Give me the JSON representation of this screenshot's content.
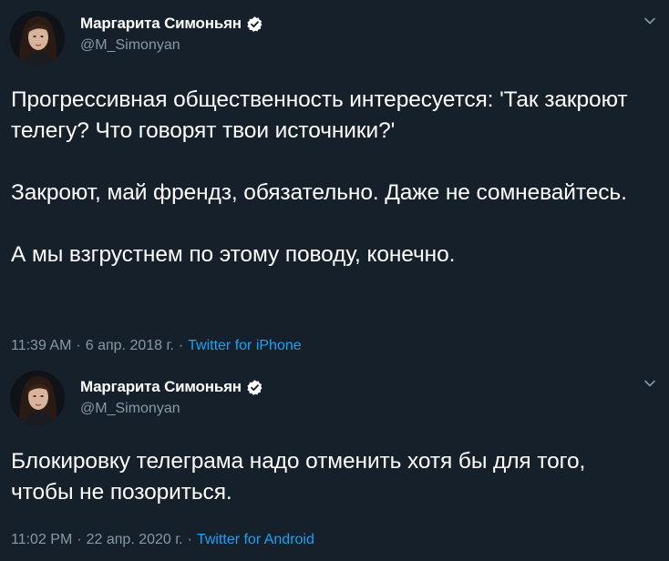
{
  "colors": {
    "background": "#15202b",
    "secondary_text": "#8899a6",
    "link": "#1da1f2",
    "verified_badge": "#ffffff"
  },
  "tweets": [
    {
      "author_name": "Маргарита Симоньян",
      "author_handle": "@M_Simonyan",
      "verified": true,
      "text": "Прогрессивная общественность интересуется: 'Так закроют телегу? Что говорят твои источники?'\n\nЗакроют, май френдз, обязательно. Даже не сомневайтесь.\n\nА мы взгрустнем по этому поводу, конечно.",
      "time": "11:39 AM",
      "separator": "·",
      "date": "6 апр. 2018 г.",
      "source": "Twitter for iPhone",
      "icons": [
        "avatar",
        "verified-badge-icon",
        "chevron-down-icon"
      ]
    },
    {
      "author_name": "Маргарита Симоньян",
      "author_handle": "@M_Simonyan",
      "verified": true,
      "text": "Блокировку телеграма надо отменить хотя бы для того, чтобы не позориться.",
      "time": "11:02 PM",
      "separator": "·",
      "date": "22 апр. 2020 г.",
      "source": "Twitter for Android",
      "icons": [
        "avatar",
        "verified-badge-icon",
        "chevron-down-icon"
      ]
    }
  ]
}
